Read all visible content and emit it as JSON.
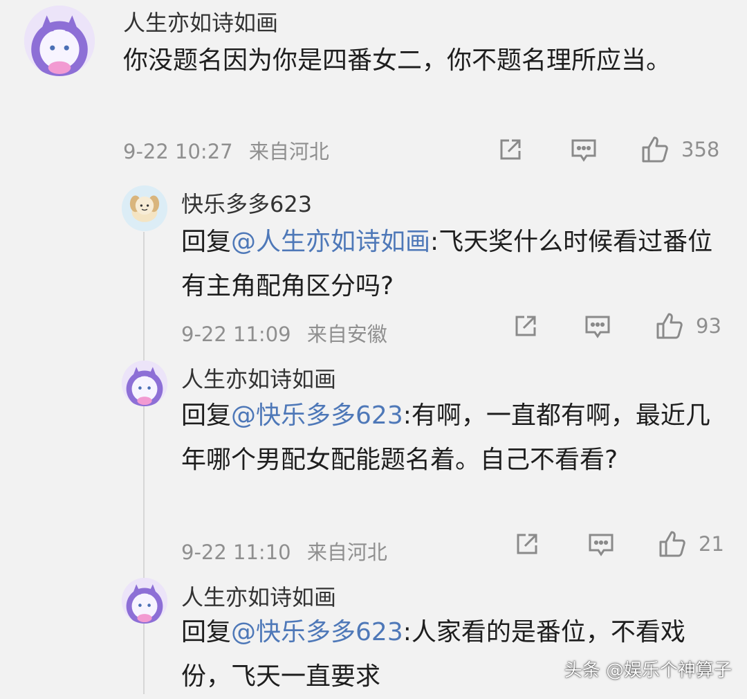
{
  "comments": [
    {
      "username": "人生亦如诗如画",
      "reply_prefix": "",
      "reply_to": "",
      "text": "你没题名因为你是四番女二，你不题名理所应当。",
      "time": "9-22 10:27",
      "location": "来自河北",
      "likes": "358"
    },
    {
      "username": "快乐多多623",
      "reply_prefix": "回复",
      "reply_to": "@人生亦如诗如画",
      "text": ":飞天奖什么时候看过番位 有主角配角区分吗?",
      "time": "9-22 11:09",
      "location": "来自安徽",
      "likes": "93"
    },
    {
      "username": "人生亦如诗如画",
      "reply_prefix": "回复",
      "reply_to": "@快乐多多623",
      "text": ":有啊，一直都有啊，最近几年哪个男配女配能题名着。自己不看看?",
      "time": "9-22 11:10",
      "location": "来自河北",
      "likes": "21"
    },
    {
      "username": "人生亦如诗如画",
      "reply_prefix": "回复",
      "reply_to": "@快乐多多623",
      "text": ":人家看的是番位，不看戏份，飞天一直要求",
      "time": "",
      "location": "",
      "likes": ""
    }
  ],
  "watermark": "头条 @娱乐个神算子",
  "icons": {
    "share": "share-icon",
    "comment": "comment-icon",
    "like": "thumbs-up-icon"
  },
  "colors": {
    "background": "#f2f2f2",
    "mention": "#4e78b8",
    "meta": "#8f8f8f"
  }
}
